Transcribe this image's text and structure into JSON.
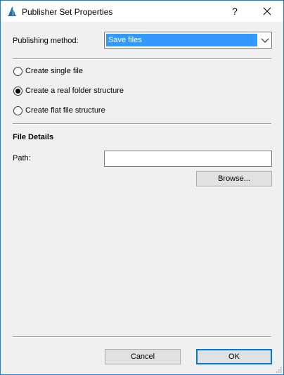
{
  "window": {
    "title": "Publisher Set Properties",
    "help_label": "?",
    "close_label": "✕",
    "app_icon": "archicad-icon"
  },
  "publishing": {
    "label": "Publishing method:",
    "selected_value": "Save files"
  },
  "options": [
    {
      "label": "Create single file",
      "checked": false
    },
    {
      "label": "Create a real folder structure",
      "checked": true
    },
    {
      "label": "Create flat file structure",
      "checked": false
    }
  ],
  "file_details": {
    "heading": "File Details",
    "path_label": "Path:",
    "path_value": "",
    "browse_label": "Browse..."
  },
  "footer": {
    "cancel_label": "Cancel",
    "ok_label": "OK"
  },
  "colors": {
    "accent": "#0078d7",
    "selection": "#3399ff",
    "window_border": "#1883d7",
    "dialog_bg": "#f0f0f0"
  }
}
